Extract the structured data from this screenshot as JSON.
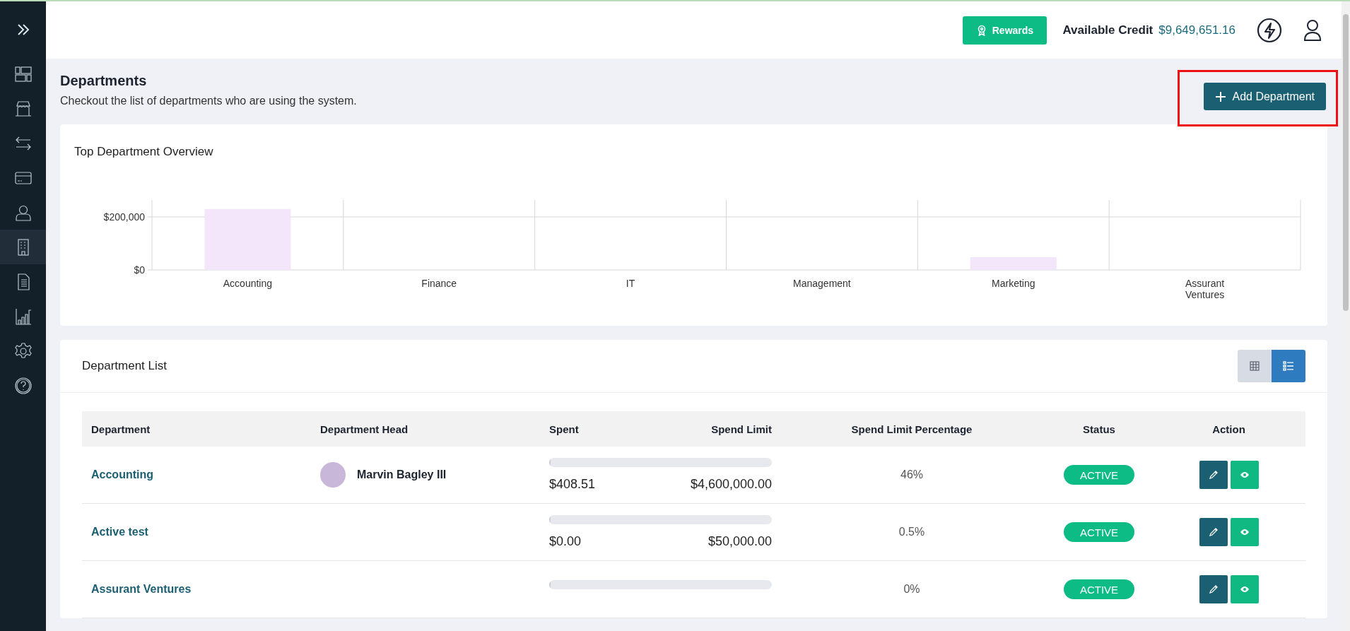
{
  "sidebar": {
    "items": [
      {
        "selected": false
      },
      {
        "selected": false
      },
      {
        "selected": false
      },
      {
        "selected": false
      },
      {
        "selected": false
      },
      {
        "selected": true
      },
      {
        "selected": false
      },
      {
        "selected": false
      },
      {
        "selected": false
      },
      {
        "selected": false
      }
    ]
  },
  "header": {
    "rewards_button": "Rewards",
    "credit_label": "Available Credit",
    "credit_value": "$9,649,651.16"
  },
  "page": {
    "title": "Departments",
    "subtitle": "Checkout the list of departments who are using the system.",
    "add_button": "Add Department",
    "add_button_highlighted": true
  },
  "overview": {
    "title": "Top Department Overview",
    "chart_data": {
      "type": "bar",
      "categories": [
        "Accounting",
        "Finance",
        "IT",
        "Management",
        "Marketing",
        "Assurant Ventures"
      ],
      "series": [
        {
          "color": "#f3e5fa",
          "values": [
            230000,
            0,
            0,
            0,
            48000,
            0
          ]
        }
      ],
      "ylim": [
        0,
        232000
      ],
      "yticks": [
        {
          "value": 0,
          "label": "$0"
        },
        {
          "value": 200000,
          "label": "$200,000"
        }
      ]
    }
  },
  "department_list": {
    "title": "Department List",
    "view_toggle": [
      {
        "selected": false
      },
      {
        "selected": true
      }
    ],
    "columns": [
      "Department",
      "Department Head",
      "Spent",
      "Spend Limit",
      "Spend Limit Percentage",
      "Status",
      "Action"
    ],
    "rows": [
      {
        "department": "Accounting",
        "head": "Marvin Bagley III",
        "has_avatar": true,
        "level": 0,
        "spent": "$408.51",
        "limit": "$4,600,000.00",
        "percentage": "46%",
        "status": "ACTIVE"
      },
      {
        "department": "Active test",
        "has_avatar": false,
        "level": 0,
        "spent": "$0.00",
        "limit": "$50,000.00",
        "percentage": "0.5%",
        "status": "ACTIVE"
      },
      {
        "department": "Assurant Ventures",
        "has_avatar": false,
        "level": 0,
        "percentage": "0%",
        "status": "ACTIVE"
      }
    ]
  }
}
